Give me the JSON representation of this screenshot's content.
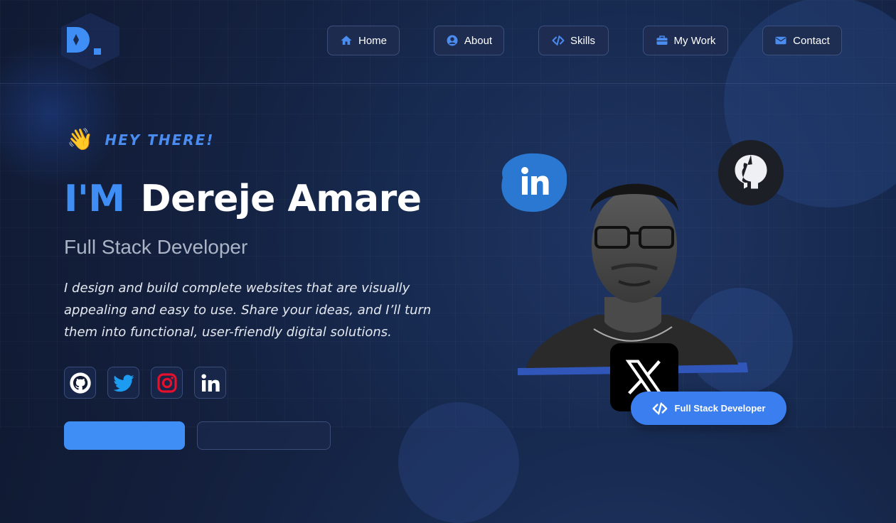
{
  "brand": {
    "logo_icon": "d-logo-icon"
  },
  "nav": [
    {
      "label": "Home",
      "icon": "home-icon"
    },
    {
      "label": "About",
      "icon": "user-circle-icon"
    },
    {
      "label": "Skills",
      "icon": "code-icon"
    },
    {
      "label": "My Work",
      "icon": "briefcase-icon"
    },
    {
      "label": "Contact",
      "icon": "envelope-icon"
    }
  ],
  "hero": {
    "greeting": "HEY THERE!",
    "greeting_icon": "waving-hand-icon",
    "intro": "I'M",
    "name": "Dereje Amare",
    "role": "Full Stack Developer",
    "description": "I design and build complete websites that are visually appealing and easy to use. Share your ideas, and I’ll turn them into functional, user-friendly digital solutions."
  },
  "socials": [
    {
      "name": "github-icon"
    },
    {
      "name": "twitter-icon"
    },
    {
      "name": "instagram-icon"
    },
    {
      "name": "linkedin-icon"
    }
  ],
  "floating": {
    "linkedin_icon": "linkedin-icon",
    "github_icon": "github-icon",
    "x_icon": "x-icon"
  },
  "badge": {
    "label": "Full Stack Developer",
    "icon": "code-icon"
  },
  "colors": {
    "accent": "#3f8ef5",
    "background": "#131f3c",
    "badge": "#3a7ef0"
  }
}
